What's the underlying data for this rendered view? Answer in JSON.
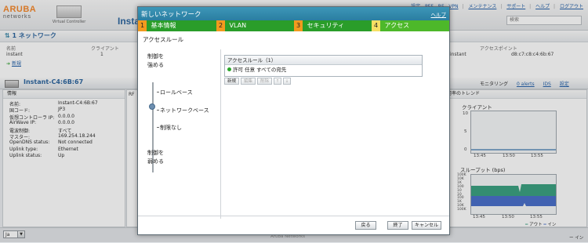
{
  "header": {
    "logo_text": "ARUBA",
    "logo_sub": "networks",
    "product": "Virtual Controller",
    "app_title": "Instant",
    "links": [
      "設定",
      "PEF",
      "RF",
      "VPN",
      "メンテナンス",
      "サポート",
      "ヘルプ",
      "ログアウト"
    ],
    "search_placeholder": "検索"
  },
  "networks": {
    "title": "1 ネットワーク",
    "col_name": "名前",
    "col_clients": "クライアント",
    "row_name": "instant",
    "row_clients": "1",
    "new_link": "新規"
  },
  "aps": {
    "col_ap": "アクセスポイント",
    "row_name": "instant",
    "row_mac": "d8:c7:c8:c4:6b:67"
  },
  "instance": {
    "name": "Instant-C4:6B:67",
    "monitoring": "モニタリング",
    "alerts": "0 alerts",
    "ids": "IDS",
    "config": "設定"
  },
  "info": {
    "title": "情報",
    "rows": [
      {
        "k": "名前:",
        "v": "Instant-C4:6B:67"
      },
      {
        "k": "国コード:",
        "v": "JP3"
      },
      {
        "k": "仮想コントローラ IP:",
        "v": "0.0.0.0"
      },
      {
        "k": "AirWave IP:",
        "v": "0.0.0.0"
      },
      {
        "k": "電波制御:",
        "v": "すべて"
      },
      {
        "k": "マスター:",
        "v": "169.254.18.244"
      },
      {
        "k": "OpenDNS status:",
        "v": "Not connected"
      },
      {
        "k": "Uplink type:",
        "v": "Ethernet"
      },
      {
        "k": "Uplink status:",
        "v": "Up"
      }
    ]
  },
  "mid": {
    "label": "RF"
  },
  "trend": {
    "title": "用率のトレンド",
    "clients_title": "クライアント",
    "clients_ticks": [
      "10",
      "5",
      "0"
    ],
    "clients_times": [
      "13:45",
      "13:50",
      "13:55"
    ],
    "throughput_title": "スループット (bps)",
    "throughput_ticks": [
      "100K",
      "10K",
      "1K",
      "100",
      "10",
      "10",
      "100",
      "1K",
      "10K",
      "100K"
    ],
    "throughput_times": [
      "13:45",
      "13:50",
      "13:55"
    ],
    "legend_out": "アウト",
    "legend_in": "イン"
  },
  "footer": {
    "lang": "Ja",
    "credit": "ー イン",
    "copyright": "Aruba Networks"
  },
  "modal": {
    "title": "新しいネットワーク",
    "help": "ヘルプ",
    "steps": [
      {
        "num": "1",
        "label": "基本情報"
      },
      {
        "num": "2",
        "label": "VLAN"
      },
      {
        "num": "3",
        "label": "セキュリティ"
      },
      {
        "num": "4",
        "label": "アクセス"
      }
    ],
    "section_title": "アクセスルール",
    "slider_top": "制御を\n強める",
    "slider_options": [
      "ロールベース",
      "ネットワークベース",
      "制限なし"
    ],
    "slider_bottom": "制御を\n弱める",
    "selected_option": "ネットワークベース",
    "rules_header": "アクセスルール（1）",
    "rule_text": "許可 任意 すべての宛先",
    "rule_buttons": [
      "新規",
      "編集",
      "削除",
      "↑",
      "↓"
    ],
    "back": "戻る",
    "finish": "終了",
    "cancel": "キャンセル"
  },
  "colors": {
    "accent": "#1f5c99",
    "modal_title": "#2a7ea1",
    "step_bg": "#2a9d2a",
    "step_num": "#f39a1e",
    "active_num": "#f6e064"
  }
}
